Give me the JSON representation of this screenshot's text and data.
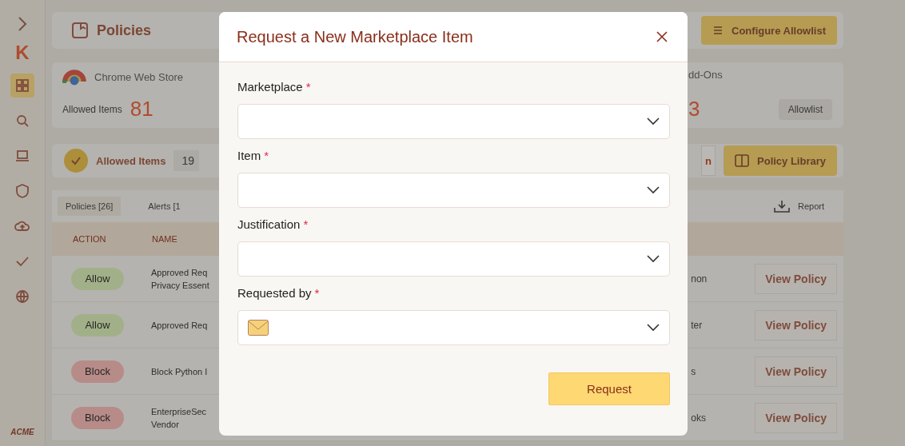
{
  "sidebar": {
    "logo": "K",
    "items": [
      {
        "kind": "grid",
        "selected": true
      },
      {
        "kind": "search",
        "selected": false
      },
      {
        "kind": "laptop",
        "selected": false
      },
      {
        "kind": "shield",
        "selected": false
      },
      {
        "kind": "cloud",
        "selected": false
      },
      {
        "kind": "check",
        "selected": false
      },
      {
        "kind": "globe",
        "selected": false
      }
    ],
    "footer_logo": "ACME"
  },
  "header": {
    "title": "Policies",
    "action": "Configure Allowlist"
  },
  "stores": {
    "left": {
      "name": "Chrome Web Store",
      "count_label": "Allowed Items",
      "count": "81"
    },
    "right": {
      "name": "dd-Ons",
      "count": "3",
      "action": "Allowlist"
    }
  },
  "filter_bar": {
    "label": "Allowed Items",
    "chip": "19",
    "partial_button": "n",
    "library": "Policy Library"
  },
  "tabs": [
    {
      "label": "Policies [26]",
      "selected": true
    },
    {
      "label": "Alerts [1",
      "selected": false
    }
  ],
  "report": "Report",
  "table": {
    "columns": [
      "ACTION",
      "NAME"
    ],
    "rows": [
      {
        "action": "Allow",
        "kind": "allow",
        "name": [
          "Approved Req",
          "Privacy Essent"
        ],
        "tail": "non",
        "button": "View Policy"
      },
      {
        "action": "Allow",
        "kind": "allow",
        "name": [
          "Approved Req"
        ],
        "tail": "ter",
        "button": "View Policy"
      },
      {
        "action": "Block",
        "kind": "block",
        "name": [
          "Block Python I"
        ],
        "tail": "s",
        "button": "View Policy"
      },
      {
        "action": "Block",
        "kind": "block",
        "name": [
          "EnterpriseSec",
          "Vendor"
        ],
        "tail": "oks",
        "button": "View Policy"
      }
    ]
  },
  "dialog": {
    "title": "Request a New Marketplace Item",
    "fields": [
      {
        "label": "Marketplace",
        "required": true,
        "kind": "select"
      },
      {
        "label": "Item",
        "required": true,
        "kind": "select"
      },
      {
        "label": "Justification",
        "required": true,
        "kind": "select"
      },
      {
        "label": "Requested by",
        "required": true,
        "kind": "email-select"
      }
    ],
    "required_mark": "*",
    "submit": "Request"
  }
}
